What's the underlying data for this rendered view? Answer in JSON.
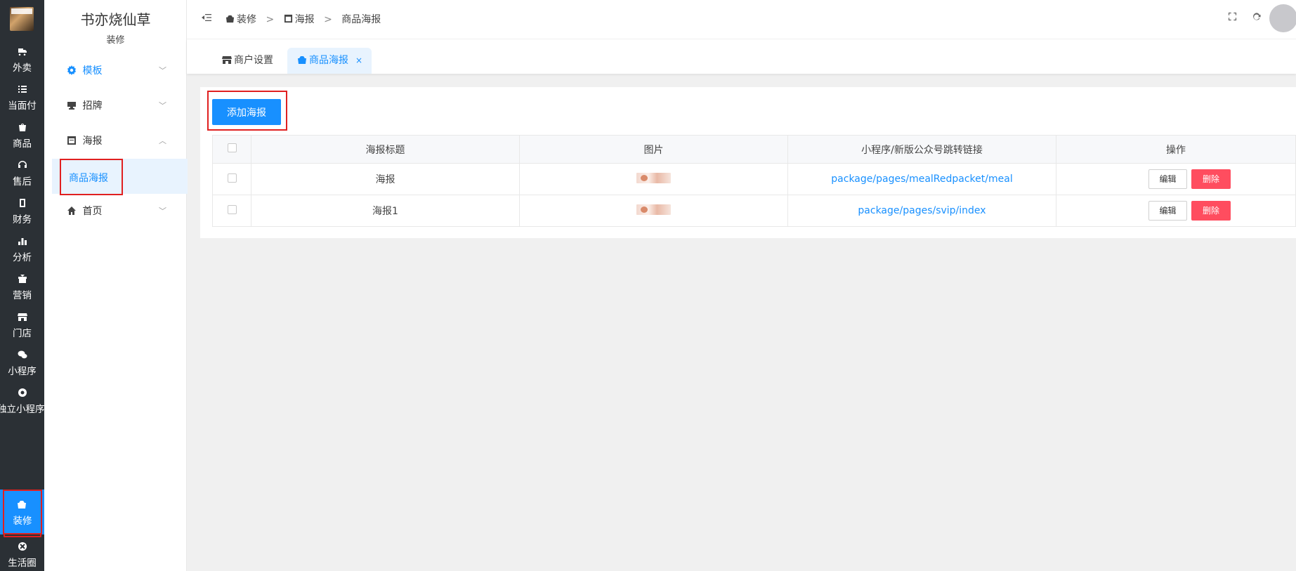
{
  "rail": {
    "items": [
      {
        "label": "外卖",
        "icon": "delivery-icon"
      },
      {
        "label": "当面付",
        "icon": "list-icon"
      },
      {
        "label": "商品",
        "icon": "shop-bag-icon"
      },
      {
        "label": "售后",
        "icon": "headset-icon"
      },
      {
        "label": "财务",
        "icon": "wallet-icon"
      },
      {
        "label": "分析",
        "icon": "bar-chart-icon"
      },
      {
        "label": "营销",
        "icon": "gift-icon"
      },
      {
        "label": "门店",
        "icon": "store-icon"
      },
      {
        "label": "小程序",
        "icon": "wechat-icon"
      },
      {
        "label": "独立小程序",
        "icon": "miniapp-icon"
      },
      {
        "label": "装修",
        "icon": "decorate-icon"
      },
      {
        "label": "生活圈",
        "icon": "circle-icon"
      }
    ]
  },
  "sidebar": {
    "title": "书亦烧仙草",
    "subtitle": "装修",
    "menu": [
      {
        "label": "模板",
        "icon": "gear-icon"
      },
      {
        "label": "招牌",
        "icon": "signboard-icon"
      },
      {
        "label": "海报",
        "icon": "poster-icon"
      },
      {
        "label": "首页",
        "icon": "home-icon"
      }
    ],
    "submenu_item": "商品海报"
  },
  "header": {
    "breadcrumb": [
      "装修",
      "海报",
      "商品海报"
    ],
    "separator": ">"
  },
  "tabs": [
    {
      "label": "商户设置",
      "icon": "store-icon"
    },
    {
      "label": "商品海报",
      "icon": "decorate-icon",
      "close": "×"
    }
  ],
  "toolbar": {
    "add_label": "添加海报"
  },
  "table": {
    "headers": [
      "海报标题",
      "图片",
      "小程序/新版公众号跳转链接",
      "操作"
    ],
    "rows": [
      {
        "title": "海报",
        "link": "package/pages/mealRedpacket/meal",
        "edit": "编辑",
        "delete": "删除"
      },
      {
        "title": "海报1",
        "link": "package/pages/svip/index",
        "edit": "编辑",
        "delete": "删除"
      }
    ]
  },
  "colors": {
    "accent": "#1890ff",
    "danger": "#ff4d5f",
    "rail_bg": "#2b3035",
    "highlight_box": "#e02020"
  }
}
